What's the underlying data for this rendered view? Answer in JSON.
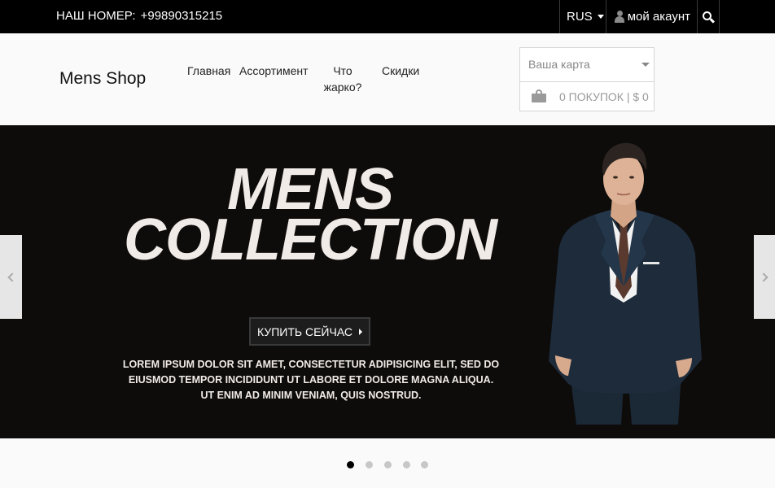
{
  "topbar": {
    "phone_label": "НАШ НОМЕР:",
    "phone_number": "+99890315215",
    "language": "RUS",
    "account_label": "мой акаунт"
  },
  "header": {
    "logo": "Mens Shop",
    "nav": [
      "Главная",
      "Ассортимент",
      "Что жарко?",
      "Скидки"
    ],
    "cart": {
      "select_label": "Ваша карта",
      "summary": "0 ПОКУПОК | $ 0"
    }
  },
  "hero": {
    "title_line1": "MENS",
    "title_line2": "COLLECTION",
    "button_label": "КУПИТЬ СЕЙЧАС",
    "description": "LOREM IPSUM DOLOR SIT AMET, CONSECTETUR ADIPISICING ELIT, SED DO EIUSMOD TEMPOR INCIDIDUNT UT LABORE ET DOLORE MAGNA ALIQUA. UT ENIM AD MINIM VENIAM, QUIS NOSTRUD."
  },
  "slider": {
    "dot_count": 5,
    "active_index": 0
  },
  "colors": {
    "topbar_bg": "#000000",
    "hero_bg": "#0d0c0b",
    "hero_text": "#f1ebe7",
    "page_bg": "#fafafa"
  },
  "icons": [
    "user-icon",
    "search-icon",
    "shopping-bag-icon",
    "chevron-left-icon",
    "chevron-right-icon",
    "caret-down-icon"
  ]
}
